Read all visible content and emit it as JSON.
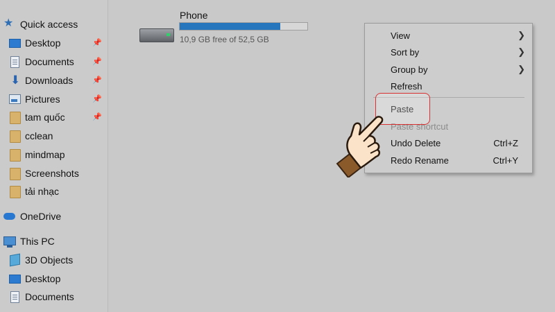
{
  "sidebar": {
    "items": [
      {
        "label": "Quick access",
        "icon": "star-icon",
        "pinned": false
      },
      {
        "label": "Desktop",
        "icon": "desktop-icon",
        "pinned": true
      },
      {
        "label": "Documents",
        "icon": "documents-icon",
        "pinned": true
      },
      {
        "label": "Downloads",
        "icon": "downloads-icon",
        "pinned": true
      },
      {
        "label": "Pictures",
        "icon": "pictures-icon",
        "pinned": true
      },
      {
        "label": "tam quốc",
        "icon": "folder-icon",
        "pinned": true
      },
      {
        "label": "cclean",
        "icon": "folder-icon",
        "pinned": false
      },
      {
        "label": "mindmap",
        "icon": "folder-icon",
        "pinned": false
      },
      {
        "label": "Screenshots",
        "icon": "folder-icon",
        "pinned": false
      },
      {
        "label": "tải nhạc",
        "icon": "folder-icon",
        "pinned": false
      },
      {
        "label": "OneDrive",
        "icon": "cloud-icon",
        "pinned": false
      },
      {
        "label": "This PC",
        "icon": "computer-icon",
        "pinned": false
      },
      {
        "label": "3D Objects",
        "icon": "cube-icon",
        "pinned": false
      },
      {
        "label": "Desktop",
        "icon": "desktop-icon",
        "pinned": false
      },
      {
        "label": "Documents",
        "icon": "documents-icon",
        "pinned": false
      }
    ],
    "pin_glyph": "📌"
  },
  "drive": {
    "name": "Phone",
    "space_text": "10,9 GB free of 52,5 GB",
    "used_fraction": 0.79,
    "icon": "hard-drive-icon"
  },
  "context_menu": {
    "items": [
      {
        "label": "View",
        "submenu": true,
        "shortcut": "",
        "disabled": false
      },
      {
        "label": "Sort by",
        "submenu": true,
        "shortcut": "",
        "disabled": false
      },
      {
        "label": "Group by",
        "submenu": true,
        "shortcut": "",
        "disabled": false
      },
      {
        "label": "Refresh",
        "submenu": false,
        "shortcut": "",
        "disabled": false
      },
      {
        "label": "Paste",
        "submenu": false,
        "shortcut": "",
        "disabled": false
      },
      {
        "label": "Paste shortcut",
        "submenu": false,
        "shortcut": "",
        "disabled": true
      },
      {
        "label": "Undo Delete",
        "submenu": false,
        "shortcut": "Ctrl+Z",
        "disabled": false
      },
      {
        "label": "Redo Rename",
        "submenu": false,
        "shortcut": "Ctrl+Y",
        "disabled": false
      }
    ],
    "submenu_arrow": "❯"
  },
  "colors": {
    "background": "#c9c9c9",
    "accent_bar": "#2676be",
    "highlight_border": "#d83030"
  }
}
